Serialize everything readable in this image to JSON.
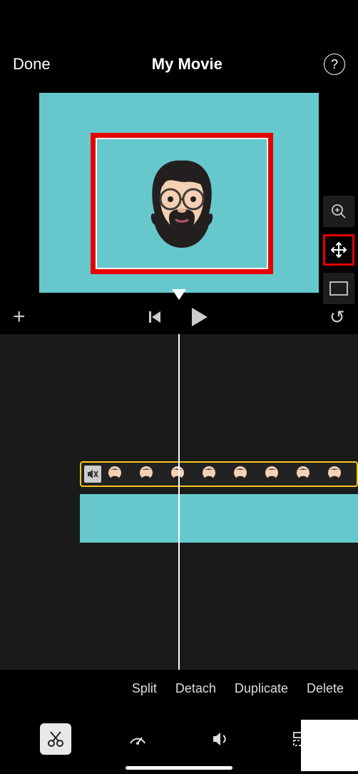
{
  "header": {
    "done_label": "Done",
    "title": "My Movie",
    "help_label": "?"
  },
  "side_tools": {
    "zoom": "zoom",
    "move": "move",
    "box": "box"
  },
  "controls": {
    "add": "+",
    "undo": "↻"
  },
  "timeline": {
    "overlay_clip": "memoji_overlay",
    "base_clip": "teal_background"
  },
  "actions": {
    "split": "Split",
    "detach": "Detach",
    "duplicate": "Duplicate",
    "delete": "Delete"
  },
  "bottom_tools": {
    "scissors": "cut",
    "speed": "speed",
    "volume": "volume",
    "titles": "titles"
  },
  "colors": {
    "teal": "#66c8cc",
    "highlight_red": "#e60000",
    "selected_yellow": "#f5c518"
  }
}
